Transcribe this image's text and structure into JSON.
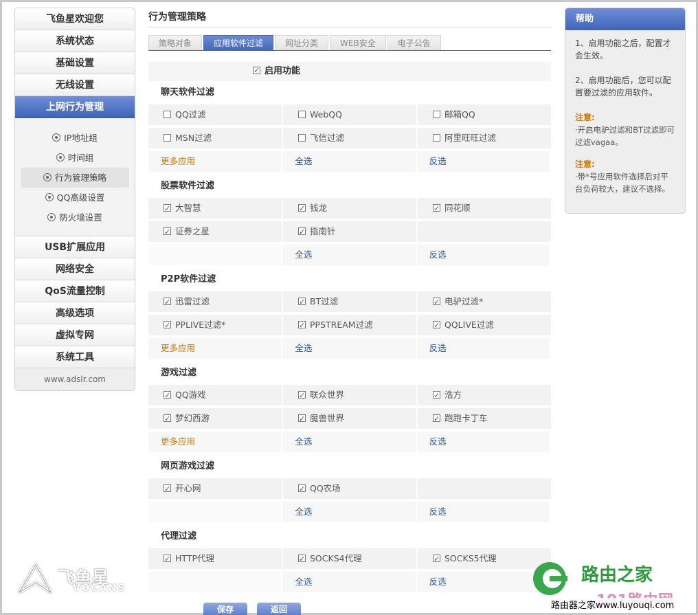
{
  "sidebar": {
    "items_top": [
      "飞鱼星欢迎您",
      "系统状态",
      "基础设置",
      "无线设置",
      "上网行为管理"
    ],
    "sub_items": [
      "IP地址组",
      "时间组",
      "行为管理策略",
      "QQ高级设置",
      "防火墙设置"
    ],
    "items_bottom": [
      "USB扩展应用",
      "网络安全",
      "QoS流量控制",
      "高级选项",
      "虚拟专网",
      "系统工具"
    ],
    "site": "www.adslr.com"
  },
  "main": {
    "title": "行为管理策略",
    "tabs": [
      "策略对象",
      "应用软件过滤",
      "网址分类",
      "WEB安全",
      "电子公告"
    ],
    "enable_label": "启用功能",
    "more_label": "更多应用",
    "select_all_label": "全选",
    "invert_label": "反选",
    "sections": [
      {
        "title": "聊天软件过滤",
        "rows": [
          [
            {
              "label": "QQ过滤",
              "checked": false
            },
            {
              "label": "WebQQ",
              "checked": false
            },
            {
              "label": "邮箱QQ",
              "checked": false
            }
          ],
          [
            {
              "label": "MSN过滤",
              "checked": false
            },
            {
              "label": "飞信过滤",
              "checked": false
            },
            {
              "label": "阿里旺旺过滤",
              "checked": false
            }
          ]
        ],
        "has_more": true
      },
      {
        "title": "股票软件过滤",
        "rows": [
          [
            {
              "label": "大智慧",
              "checked": true
            },
            {
              "label": "钱龙",
              "checked": true
            },
            {
              "label": "同花顺",
              "checked": true
            }
          ],
          [
            {
              "label": "证券之星",
              "checked": true
            },
            {
              "label": "指南针",
              "checked": true
            },
            null
          ]
        ],
        "has_more": false
      },
      {
        "title": "P2P软件过滤",
        "rows": [
          [
            {
              "label": "迅雷过滤",
              "checked": true
            },
            {
              "label": "BT过滤",
              "checked": true
            },
            {
              "label": "电驴过滤*",
              "checked": true
            }
          ],
          [
            {
              "label": "PPLIVE过滤*",
              "checked": true
            },
            {
              "label": "PPSTREAM过滤",
              "checked": true
            },
            {
              "label": "QQLIVE过滤",
              "checked": true
            }
          ]
        ],
        "has_more": true
      },
      {
        "title": "游戏过滤",
        "rows": [
          [
            {
              "label": "QQ游戏",
              "checked": true
            },
            {
              "label": "联众世界",
              "checked": true
            },
            {
              "label": "浩方",
              "checked": true
            }
          ],
          [
            {
              "label": "梦幻西游",
              "checked": true
            },
            {
              "label": "魔兽世界",
              "checked": true
            },
            {
              "label": "跑跑卡丁车",
              "checked": true
            }
          ]
        ],
        "has_more": true
      },
      {
        "title": "网页游戏过滤",
        "rows": [
          [
            {
              "label": "开心网",
              "checked": true
            },
            {
              "label": "QQ农场",
              "checked": true
            },
            null
          ]
        ],
        "has_more": false
      },
      {
        "title": "代理过滤",
        "rows": [
          [
            {
              "label": "HTTP代理",
              "checked": true
            },
            {
              "label": "SOCKS4代理",
              "checked": true
            },
            {
              "label": "SOCKS5代理",
              "checked": true
            }
          ]
        ],
        "has_more": false
      }
    ],
    "buttons": [
      "保存",
      "返回"
    ]
  },
  "help": {
    "title": "帮助",
    "p1": "1、启用功能之后，配置才会生效。",
    "p2": "2、启用功能后，您可以配置要过滤的应用软件。",
    "note1_title": "注意:",
    "note1_text": "·开启电驴过滤和BT过滤即可过滤vagaa。",
    "note2_title": "注意:",
    "note2_text": "·带*号应用软件选择后对平台负荷较大，建议不选择。"
  },
  "logos": {
    "vocans_cn": "飞鱼星",
    "vocans_en": "VOCANS",
    "router_name": "路由之家",
    "router_url": "路由器之家www.luyouqi.com",
    "watermark": "191路由网"
  }
}
